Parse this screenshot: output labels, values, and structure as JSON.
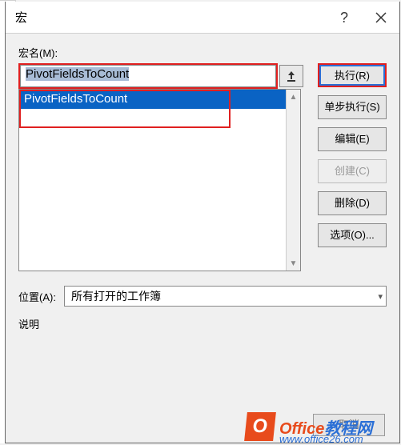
{
  "titlebar": {
    "title": "宏"
  },
  "labels": {
    "macro_name": "宏名(M):",
    "location": "位置(A):",
    "description": "说明"
  },
  "macro_input_value": "PivotFieldsToCount",
  "macro_list": [
    {
      "name": "PivotFieldsToCount",
      "selected": true
    }
  ],
  "location_value": "所有打开的工作簿",
  "buttons": {
    "run": "执行(R)",
    "step": "单步执行(S)",
    "edit": "编辑(E)",
    "create": "创建(C)",
    "delete": "删除(D)",
    "options": "选项(O)...",
    "cancel": "取消"
  },
  "watermark": {
    "brand_a": "Office",
    "brand_b": "教程网",
    "url": "www.office26.com"
  }
}
